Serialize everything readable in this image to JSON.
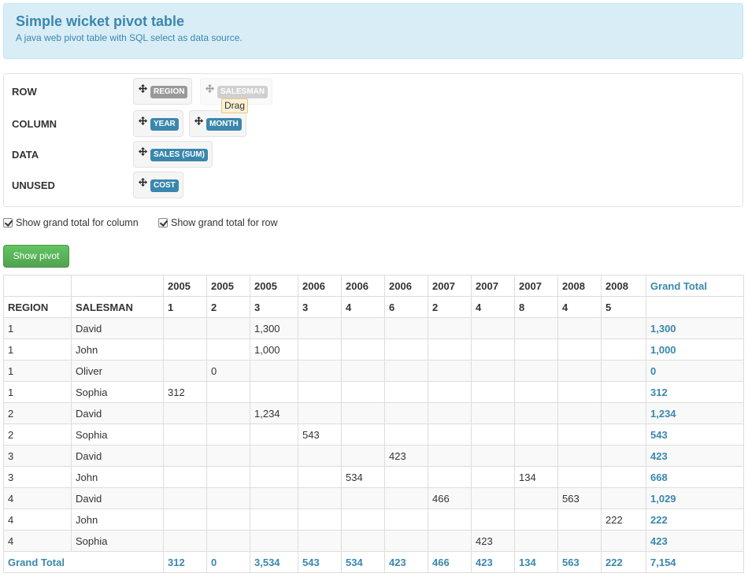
{
  "header": {
    "title": "Simple wicket pivot table",
    "subtitle": "A java web pivot table with SQL select as data source."
  },
  "areas": {
    "row": {
      "label": "ROW",
      "fields": [
        "REGION",
        "SALESMAN"
      ]
    },
    "column": {
      "label": "COLUMN",
      "fields": [
        "YEAR",
        "MONTH"
      ]
    },
    "data": {
      "label": "DATA",
      "fields": [
        "SALES (SUM)"
      ]
    },
    "unused": {
      "label": "UNUSED",
      "fields": [
        "COST"
      ]
    },
    "drag_tooltip": "Drag"
  },
  "options": {
    "grand_total_column": "Show grand total for column",
    "grand_total_row": "Show grand total for row"
  },
  "show_pivot_label": "Show pivot",
  "table": {
    "years": [
      "2005",
      "2005",
      "2005",
      "2006",
      "2006",
      "2006",
      "2007",
      "2007",
      "2007",
      "2008",
      "2008"
    ],
    "months": [
      "1",
      "2",
      "3",
      "3",
      "4",
      "6",
      "2",
      "4",
      "8",
      "4",
      "5"
    ],
    "grand_total_header": "Grand Total",
    "row_headers": [
      "REGION",
      "SALESMAN"
    ],
    "rows": [
      {
        "region": "1",
        "salesman": "David",
        "cells": [
          "",
          "",
          "1,300",
          "",
          "",
          "",
          "",
          "",
          "",
          "",
          ""
        ],
        "total": "1,300"
      },
      {
        "region": "1",
        "salesman": "John",
        "cells": [
          "",
          "",
          "1,000",
          "",
          "",
          "",
          "",
          "",
          "",
          "",
          ""
        ],
        "total": "1,000"
      },
      {
        "region": "1",
        "salesman": "Oliver",
        "cells": [
          "",
          "0",
          "",
          "",
          "",
          "",
          "",
          "",
          "",
          "",
          ""
        ],
        "total": "0"
      },
      {
        "region": "1",
        "salesman": "Sophia",
        "cells": [
          "312",
          "",
          "",
          "",
          "",
          "",
          "",
          "",
          "",
          "",
          ""
        ],
        "total": "312"
      },
      {
        "region": "2",
        "salesman": "David",
        "cells": [
          "",
          "",
          "1,234",
          "",
          "",
          "",
          "",
          "",
          "",
          "",
          ""
        ],
        "total": "1,234"
      },
      {
        "region": "2",
        "salesman": "Sophia",
        "cells": [
          "",
          "",
          "",
          "543",
          "",
          "",
          "",
          "",
          "",
          "",
          ""
        ],
        "total": "543"
      },
      {
        "region": "3",
        "salesman": "David",
        "cells": [
          "",
          "",
          "",
          "",
          "",
          "423",
          "",
          "",
          "",
          "",
          ""
        ],
        "total": "423"
      },
      {
        "region": "3",
        "salesman": "John",
        "cells": [
          "",
          "",
          "",
          "",
          "534",
          "",
          "",
          "",
          "134",
          "",
          ""
        ],
        "total": "668"
      },
      {
        "region": "4",
        "salesman": "David",
        "cells": [
          "",
          "",
          "",
          "",
          "",
          "",
          "466",
          "",
          "",
          "563",
          ""
        ],
        "total": "1,029"
      },
      {
        "region": "4",
        "salesman": "John",
        "cells": [
          "",
          "",
          "",
          "",
          "",
          "",
          "",
          "",
          "",
          "",
          "222"
        ],
        "total": "222"
      },
      {
        "region": "4",
        "salesman": "Sophia",
        "cells": [
          "",
          "",
          "",
          "",
          "",
          "",
          "",
          "423",
          "",
          "",
          ""
        ],
        "total": "423"
      }
    ],
    "grand_total_row": {
      "label": "Grand Total",
      "cells": [
        "312",
        "0",
        "3,534",
        "543",
        "534",
        "423",
        "466",
        "423",
        "134",
        "563",
        "222"
      ],
      "total": "7,154"
    }
  },
  "colors": {
    "accent": "#3a87ad",
    "hero_bg": "#d9edf7",
    "button": "#5bb75b",
    "badge_unused": "#999999"
  }
}
